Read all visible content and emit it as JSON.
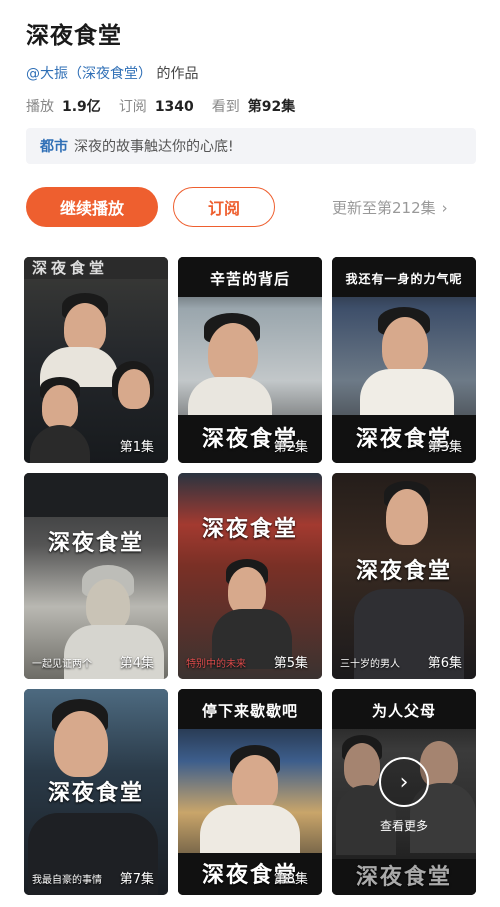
{
  "show": {
    "title": "深夜食堂",
    "author_link": "@大振（深夜食堂）",
    "author_suffix": "的作品"
  },
  "stats": {
    "play_label": "播放",
    "play_value": "1.9亿",
    "sub_label": "订阅",
    "sub_value": "1340",
    "watched_label": "看到",
    "watched_value": "第92集"
  },
  "tagline": {
    "tag": "都市",
    "text": "深夜的故事触达你的心底!"
  },
  "actions": {
    "continue_label": "继续播放",
    "subscribe_label": "订阅",
    "update_label": "更新至第212集",
    "update_chevron": "›"
  },
  "colors": {
    "accent": "#ee5f2f",
    "link": "#2f6fb6"
  },
  "episodes": [
    {
      "label": "第1集",
      "logo": "深夜食堂",
      "caption": ""
    },
    {
      "label": "第2集",
      "logo": "深夜食堂",
      "caption": "辛苦的背后"
    },
    {
      "label": "第3集",
      "logo": "深夜食堂",
      "caption": "我还有一身的力气呢"
    },
    {
      "label": "第4集",
      "logo": "深夜食堂",
      "subtitle": "一起见证两个"
    },
    {
      "label": "第5集",
      "logo": "深夜食堂",
      "subtitle": "特别中的未来"
    },
    {
      "label": "第6集",
      "logo": "深夜食堂",
      "subtitle": "三十岁的男人"
    },
    {
      "label": "第7集",
      "logo": "深夜食堂",
      "subtitle": "我最自豪的事情"
    },
    {
      "label": "第8集",
      "logo": "深夜食堂",
      "caption": "停下来歇歇吧"
    },
    {
      "label": "",
      "logo": "深夜食堂",
      "caption": "为人父母",
      "more_label": "查看更多",
      "more_icon": "chevron-right-icon"
    }
  ]
}
